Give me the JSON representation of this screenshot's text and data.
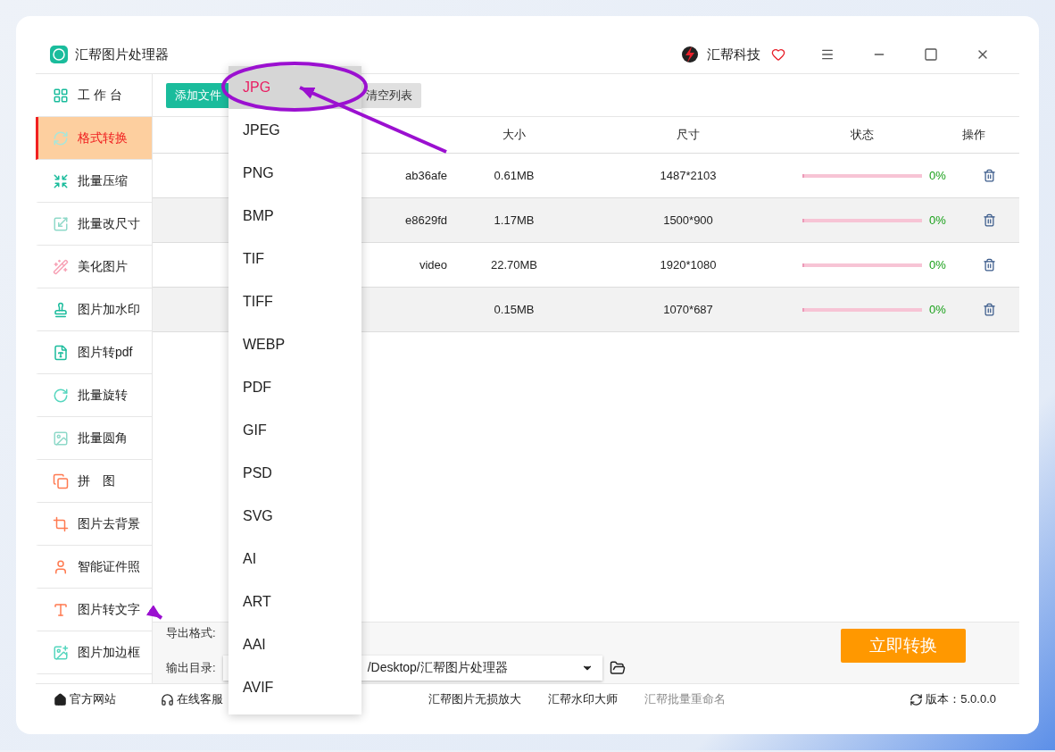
{
  "window": {
    "title": "汇帮图片处理器",
    "brand": "汇帮科技"
  },
  "sidebar": {
    "items": [
      {
        "label": "工 作 台",
        "selected": false
      },
      {
        "label": "格式转换",
        "selected": true
      },
      {
        "label": "批量压缩",
        "selected": false
      },
      {
        "label": "批量改尺寸",
        "selected": false
      },
      {
        "label": "美化图片",
        "selected": false
      },
      {
        "label": "图片加水印",
        "selected": false
      },
      {
        "label": "图片转pdf",
        "selected": false
      },
      {
        "label": "批量旋转",
        "selected": false
      },
      {
        "label": "批量圆角",
        "selected": false
      },
      {
        "label": "拼　图",
        "selected": false
      },
      {
        "label": "图片去背景",
        "selected": false
      },
      {
        "label": "智能证件照",
        "selected": false
      },
      {
        "label": "图片转文字",
        "selected": false
      },
      {
        "label": "图片加边框",
        "selected": false
      }
    ]
  },
  "toolbar": {
    "add_button": "添加文件",
    "clear_button": "清空列表"
  },
  "table": {
    "columns": [
      "大小",
      "尺寸",
      "状态",
      "操作"
    ],
    "rows": [
      {
        "name": "ab36afe",
        "size": "0.61MB",
        "dimensions": "1487*2103",
        "level": 0,
        "percent": "0%"
      },
      {
        "name": "e8629fd",
        "size": "1.17MB",
        "dimensions": "1500*900",
        "level": 0,
        "percent": "0%"
      },
      {
        "name": "video",
        "size": "22.70MB",
        "dimensions": "1920*1080",
        "level": 0,
        "percent": "0%"
      },
      {
        "size": "0.15MB",
        "dimensions": "1070*687",
        "level": 0,
        "percent": "0%"
      }
    ]
  },
  "output": {
    "format_label": "导出格式:",
    "dir_label": "输出目录:",
    "dir_value": "/Desktop/汇帮图片处理器",
    "convert_button": "立即转换"
  },
  "format_menu": {
    "items": [
      {
        "label": "JPG",
        "selected": true
      },
      {
        "label": "JPEG",
        "selected": false
      },
      {
        "label": "PNG",
        "selected": false
      },
      {
        "label": "BMP",
        "selected": false
      },
      {
        "label": "TIF",
        "selected": false
      },
      {
        "label": "TIFF",
        "selected": false
      },
      {
        "label": "WEBP",
        "selected": false
      },
      {
        "label": "PDF",
        "selected": false
      },
      {
        "label": "GIF",
        "selected": false
      },
      {
        "label": "PSD",
        "selected": false
      },
      {
        "label": "SVG",
        "selected": false
      },
      {
        "label": "AI",
        "selected": false
      },
      {
        "label": "ART",
        "selected": false
      },
      {
        "label": "AAI",
        "selected": false
      },
      {
        "label": "AVIF",
        "selected": false
      }
    ]
  },
  "status_bar": {
    "website": "官方网站",
    "support": "在线客服",
    "links": [
      {
        "label": "汇帮图片无损放大",
        "muted": false
      },
      {
        "label": "汇帮水印大师",
        "muted": false
      },
      {
        "label": "汇帮批量重命名",
        "muted": true
      }
    ],
    "version": "版本：5.0.0.0"
  }
}
